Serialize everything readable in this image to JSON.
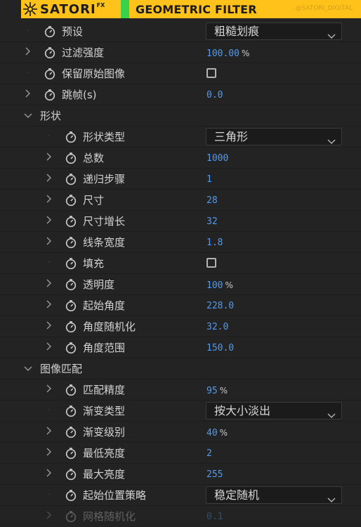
{
  "header": {
    "brand": "SATORI",
    "brand_suffix": "FX",
    "plugin_title": "GEOMETRIC FILTER",
    "watermark": "@SATORI_DIGITAL"
  },
  "colors": {
    "accent_yellow": "#ffc21a",
    "accent_green": "#39d34b",
    "value_blue": "#4d9cf5",
    "panel_bg": "#232323"
  },
  "rows": [
    {
      "id": "preset",
      "label": "预设",
      "control": "dropdown",
      "value": "粗糙划痕",
      "arrow": "none"
    },
    {
      "id": "filter-strength",
      "label": "过滤强度",
      "control": "value",
      "value": "100.00",
      "unit": "%",
      "arrow": "collapsed"
    },
    {
      "id": "keep-original",
      "label": "保留原始图像",
      "control": "checkbox",
      "checked": false,
      "arrow": "none"
    },
    {
      "id": "frame-skip",
      "label": "跳帧(s)",
      "control": "value",
      "value": "0.0",
      "arrow": "collapsed"
    },
    {
      "id": "shape-group",
      "label": "形状",
      "control": "section",
      "arrow": "expanded"
    },
    {
      "id": "shape-type",
      "label": "形状类型",
      "control": "dropdown",
      "value": "三角形",
      "arrow": "none"
    },
    {
      "id": "total",
      "label": "总数",
      "control": "value",
      "value": "1000",
      "arrow": "collapsed"
    },
    {
      "id": "recursion-steps",
      "label": "递归步骤",
      "control": "value",
      "value": "1",
      "arrow": "collapsed"
    },
    {
      "id": "size",
      "label": "尺寸",
      "control": "value",
      "value": "28",
      "arrow": "collapsed"
    },
    {
      "id": "size-growth",
      "label": "尺寸增长",
      "control": "value",
      "value": "32",
      "arrow": "collapsed"
    },
    {
      "id": "line-width",
      "label": "线条宽度",
      "control": "value",
      "value": "1.8",
      "arrow": "collapsed"
    },
    {
      "id": "fill",
      "label": "填充",
      "control": "checkbox",
      "checked": false,
      "arrow": "none"
    },
    {
      "id": "opacity",
      "label": "透明度",
      "control": "value",
      "value": "100",
      "unit": "%",
      "arrow": "collapsed"
    },
    {
      "id": "start-angle",
      "label": "起始角度",
      "control": "value",
      "value": "228.0",
      "arrow": "collapsed"
    },
    {
      "id": "angle-randomize",
      "label": "角度随机化",
      "control": "value",
      "value": "32.0",
      "arrow": "collapsed"
    },
    {
      "id": "angle-range",
      "label": "角度范围",
      "control": "value",
      "value": "150.0",
      "arrow": "collapsed"
    },
    {
      "id": "image-match-group",
      "label": "图像匹配",
      "control": "section",
      "arrow": "expanded"
    },
    {
      "id": "match-precision",
      "label": "匹配精度",
      "control": "value",
      "value": "95",
      "unit": "%",
      "arrow": "collapsed"
    },
    {
      "id": "gradient-type",
      "label": "渐变类型",
      "control": "dropdown",
      "value": "按大小淡出",
      "arrow": "none"
    },
    {
      "id": "gradient-level",
      "label": "渐变级别",
      "control": "value",
      "value": "40",
      "unit": "%",
      "arrow": "collapsed"
    },
    {
      "id": "min-brightness",
      "label": "最低亮度",
      "control": "value",
      "value": "2",
      "arrow": "collapsed"
    },
    {
      "id": "max-brightness",
      "label": "最大亮度",
      "control": "value",
      "value": "255",
      "arrow": "collapsed"
    },
    {
      "id": "start-position-strategy",
      "label": "起始位置策略",
      "control": "dropdown",
      "value": "稳定随机",
      "arrow": "none"
    },
    {
      "id": "grid-randomize",
      "label": "网格随机化",
      "control": "value",
      "value": "0.1",
      "arrow": "collapsed",
      "faded": true
    }
  ]
}
